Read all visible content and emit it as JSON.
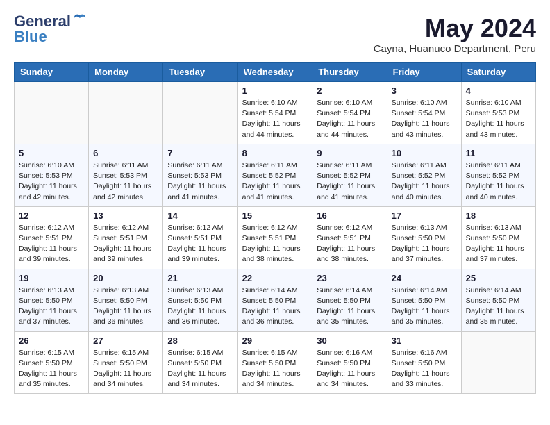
{
  "logo": {
    "general": "General",
    "blue": "Blue"
  },
  "title": "May 2024",
  "subtitle": "Cayna, Huanuco Department, Peru",
  "weekdays": [
    "Sunday",
    "Monday",
    "Tuesday",
    "Wednesday",
    "Thursday",
    "Friday",
    "Saturday"
  ],
  "weeks": [
    [
      {
        "day": "",
        "info": ""
      },
      {
        "day": "",
        "info": ""
      },
      {
        "day": "",
        "info": ""
      },
      {
        "day": "1",
        "info": "Sunrise: 6:10 AM\nSunset: 5:54 PM\nDaylight: 11 hours and 44 minutes."
      },
      {
        "day": "2",
        "info": "Sunrise: 6:10 AM\nSunset: 5:54 PM\nDaylight: 11 hours and 44 minutes."
      },
      {
        "day": "3",
        "info": "Sunrise: 6:10 AM\nSunset: 5:54 PM\nDaylight: 11 hours and 43 minutes."
      },
      {
        "day": "4",
        "info": "Sunrise: 6:10 AM\nSunset: 5:53 PM\nDaylight: 11 hours and 43 minutes."
      }
    ],
    [
      {
        "day": "5",
        "info": "Sunrise: 6:10 AM\nSunset: 5:53 PM\nDaylight: 11 hours and 42 minutes."
      },
      {
        "day": "6",
        "info": "Sunrise: 6:11 AM\nSunset: 5:53 PM\nDaylight: 11 hours and 42 minutes."
      },
      {
        "day": "7",
        "info": "Sunrise: 6:11 AM\nSunset: 5:53 PM\nDaylight: 11 hours and 41 minutes."
      },
      {
        "day": "8",
        "info": "Sunrise: 6:11 AM\nSunset: 5:52 PM\nDaylight: 11 hours and 41 minutes."
      },
      {
        "day": "9",
        "info": "Sunrise: 6:11 AM\nSunset: 5:52 PM\nDaylight: 11 hours and 41 minutes."
      },
      {
        "day": "10",
        "info": "Sunrise: 6:11 AM\nSunset: 5:52 PM\nDaylight: 11 hours and 40 minutes."
      },
      {
        "day": "11",
        "info": "Sunrise: 6:11 AM\nSunset: 5:52 PM\nDaylight: 11 hours and 40 minutes."
      }
    ],
    [
      {
        "day": "12",
        "info": "Sunrise: 6:12 AM\nSunset: 5:51 PM\nDaylight: 11 hours and 39 minutes."
      },
      {
        "day": "13",
        "info": "Sunrise: 6:12 AM\nSunset: 5:51 PM\nDaylight: 11 hours and 39 minutes."
      },
      {
        "day": "14",
        "info": "Sunrise: 6:12 AM\nSunset: 5:51 PM\nDaylight: 11 hours and 39 minutes."
      },
      {
        "day": "15",
        "info": "Sunrise: 6:12 AM\nSunset: 5:51 PM\nDaylight: 11 hours and 38 minutes."
      },
      {
        "day": "16",
        "info": "Sunrise: 6:12 AM\nSunset: 5:51 PM\nDaylight: 11 hours and 38 minutes."
      },
      {
        "day": "17",
        "info": "Sunrise: 6:13 AM\nSunset: 5:50 PM\nDaylight: 11 hours and 37 minutes."
      },
      {
        "day": "18",
        "info": "Sunrise: 6:13 AM\nSunset: 5:50 PM\nDaylight: 11 hours and 37 minutes."
      }
    ],
    [
      {
        "day": "19",
        "info": "Sunrise: 6:13 AM\nSunset: 5:50 PM\nDaylight: 11 hours and 37 minutes."
      },
      {
        "day": "20",
        "info": "Sunrise: 6:13 AM\nSunset: 5:50 PM\nDaylight: 11 hours and 36 minutes."
      },
      {
        "day": "21",
        "info": "Sunrise: 6:13 AM\nSunset: 5:50 PM\nDaylight: 11 hours and 36 minutes."
      },
      {
        "day": "22",
        "info": "Sunrise: 6:14 AM\nSunset: 5:50 PM\nDaylight: 11 hours and 36 minutes."
      },
      {
        "day": "23",
        "info": "Sunrise: 6:14 AM\nSunset: 5:50 PM\nDaylight: 11 hours and 35 minutes."
      },
      {
        "day": "24",
        "info": "Sunrise: 6:14 AM\nSunset: 5:50 PM\nDaylight: 11 hours and 35 minutes."
      },
      {
        "day": "25",
        "info": "Sunrise: 6:14 AM\nSunset: 5:50 PM\nDaylight: 11 hours and 35 minutes."
      }
    ],
    [
      {
        "day": "26",
        "info": "Sunrise: 6:15 AM\nSunset: 5:50 PM\nDaylight: 11 hours and 35 minutes."
      },
      {
        "day": "27",
        "info": "Sunrise: 6:15 AM\nSunset: 5:50 PM\nDaylight: 11 hours and 34 minutes."
      },
      {
        "day": "28",
        "info": "Sunrise: 6:15 AM\nSunset: 5:50 PM\nDaylight: 11 hours and 34 minutes."
      },
      {
        "day": "29",
        "info": "Sunrise: 6:15 AM\nSunset: 5:50 PM\nDaylight: 11 hours and 34 minutes."
      },
      {
        "day": "30",
        "info": "Sunrise: 6:16 AM\nSunset: 5:50 PM\nDaylight: 11 hours and 34 minutes."
      },
      {
        "day": "31",
        "info": "Sunrise: 6:16 AM\nSunset: 5:50 PM\nDaylight: 11 hours and 33 minutes."
      },
      {
        "day": "",
        "info": ""
      }
    ]
  ]
}
